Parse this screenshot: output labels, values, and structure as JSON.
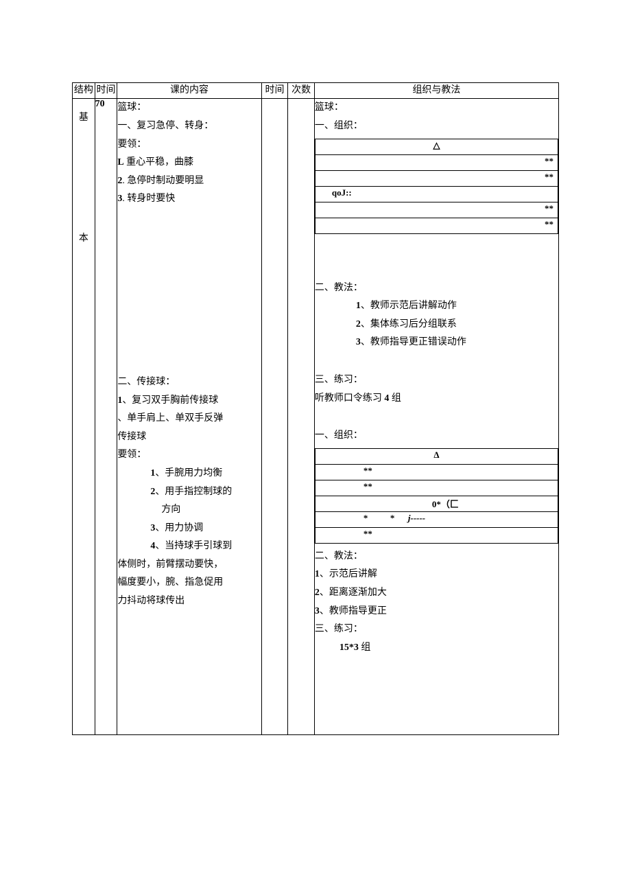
{
  "headers": {
    "structure": "结构",
    "time1": "时间",
    "content": "课的内容",
    "time2": "时间",
    "count": "次数",
    "org": "组织与教法"
  },
  "structure_label_1": "基",
  "structure_label_2": "本",
  "time_value": "70",
  "content": {
    "s1_title": "篮球：",
    "s1_a": "一、复习急停、转身：",
    "s1_b": "要领：",
    "s1_c": "L 重心平稳，曲膝",
    "s1_d": "2. 急停时制动要明显",
    "s1_e": "3. 转身时要快",
    "s2_a": "二、传接球：",
    "s2_b": "1、复习双手胸前传接球",
    "s2_c": "、单手肩上、单双手反弹",
    "s2_d": "传接球",
    "s2_e": "要领：",
    "s2_f": "1、手腕用力均衡",
    "s2_g": "2、用手指控制球的",
    "s2_g2": "方向",
    "s2_h": "3、用力协调",
    "s2_i": "4、当持球手引球到",
    "s2_j": "体侧时，前臂摆动要快，",
    "s2_k": "幅度要小，腕、指急促用",
    "s2_l": "力抖动将球传出"
  },
  "org": {
    "s1_title": "篮球：",
    "s1_a": "一、组织：",
    "form1_r1": "△",
    "form1_r2": "**",
    "form1_r3": "**",
    "form1_r4": "qoJ::",
    "form1_r5": "**",
    "form1_r6": "**",
    "s1_b": "二、教法：",
    "s1_b1": "1、教师示范后讲解动作",
    "s1_b2": "2、集体练习后分组联系",
    "s1_b3": "3、教师指导更正错误动作",
    "s1_c": "三、练习：",
    "s1_c1": "听教师口令练习 4 组",
    "s2_a": "一、组织：",
    "form2_r1": "Δ",
    "form2_r2": "**",
    "form2_r3": "**",
    "form2_r4": "0*（匚",
    "form2_r5a": "*",
    "form2_r5b": "*",
    "form2_r5c": "j-----",
    "form2_r6": "**",
    "s2_b": "二、教法：",
    "s2_b1": "1、示范后讲解",
    "s2_b2": "2、距离逐渐加大",
    "s2_b3": "3、教师指导更正",
    "s2_c": "三、练习：",
    "s2_c1": "15*3 组"
  }
}
